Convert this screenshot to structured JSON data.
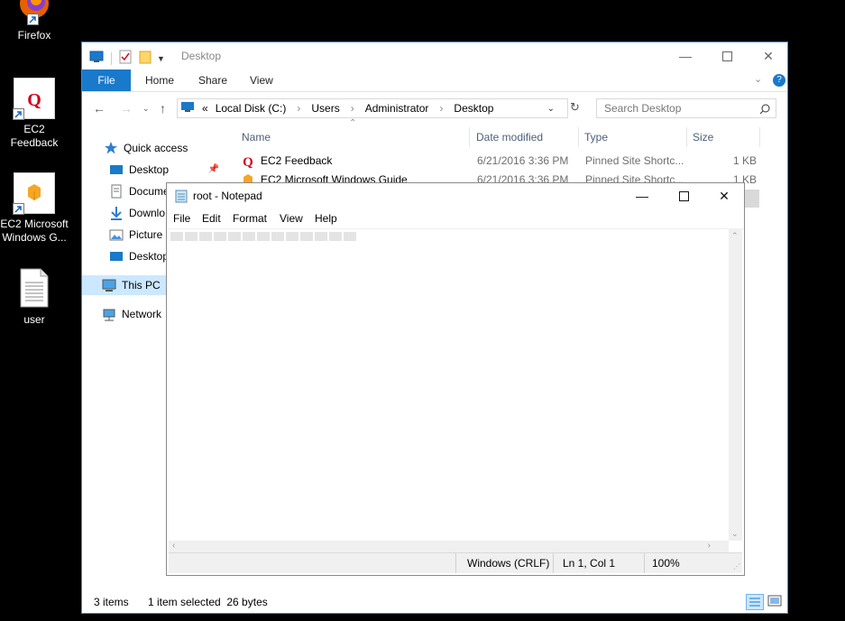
{
  "desktop": {
    "icons": [
      {
        "label": "Firefox",
        "icon": "firefox-icon"
      },
      {
        "label": "EC2 Feedback",
        "icon": "ec2-feedback-icon"
      },
      {
        "label": "EC2 Microsoft Windows G...",
        "icon": "ec2-guide-icon"
      },
      {
        "label": "user",
        "icon": "text-file-icon"
      }
    ]
  },
  "explorer": {
    "title": "Desktop",
    "ribbon_tabs": [
      "File",
      "Home",
      "Share",
      "View"
    ],
    "address": [
      "Local Disk (C:)",
      "Users",
      "Administrator",
      "Desktop"
    ],
    "address_prefix": "«",
    "search_placeholder": "Search Desktop",
    "nav": {
      "quick_access": "Quick access",
      "items": [
        "Desktop",
        "Docume",
        "Downlo",
        "Picture",
        "Desktop"
      ],
      "this_pc": "This PC",
      "network": "Network"
    },
    "columns": [
      "Name",
      "Date modified",
      "Type",
      "Size"
    ],
    "files": [
      {
        "name": "EC2 Feedback",
        "date": "6/21/2016 3:36 PM",
        "type": "Pinned Site Shortc...",
        "size": "1 KB"
      },
      {
        "name": "EC2 Microsoft Windows Guide",
        "date": "6/21/2016 3:36 PM",
        "type": "Pinned Site Shortc...",
        "size": "1 KB"
      }
    ],
    "status": {
      "items": "3 items",
      "selected": "1 item selected  26 bytes"
    },
    "accent": "#1979ca"
  },
  "notepad": {
    "title": "root - Notepad",
    "menu": [
      "File",
      "Edit",
      "Format",
      "View",
      "Help"
    ],
    "status": {
      "encoding": "Windows (CRLF)",
      "position": "Ln 1, Col 1",
      "zoom": "100%"
    }
  }
}
